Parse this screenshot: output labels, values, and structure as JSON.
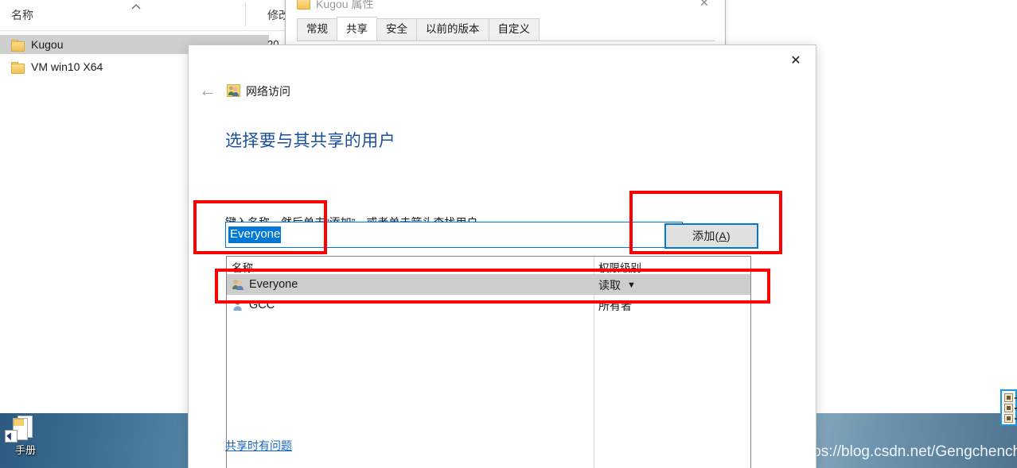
{
  "explorer": {
    "columns": [
      {
        "label": "名称",
        "name": "column-header-name"
      },
      {
        "label": "修改",
        "name": "column-header-modified"
      }
    ],
    "sort_indicator": "sort-ascending-chevron-icon",
    "rows": [
      {
        "name": "Kugou",
        "icon": "folder-icon",
        "selected": true,
        "modified": "20"
      },
      {
        "name": "VM win10 X64",
        "icon": "folder-icon",
        "selected": false,
        "modified": ""
      }
    ]
  },
  "properties_window": {
    "title": "Kugou 属性",
    "icon": "folder-icon",
    "close_label": "✕",
    "tabs": [
      {
        "label": "常规",
        "active": false
      },
      {
        "label": "共享",
        "active": true
      },
      {
        "label": "安全",
        "active": false
      },
      {
        "label": "以前的版本",
        "active": false
      },
      {
        "label": "自定义",
        "active": false
      }
    ]
  },
  "share_dialog": {
    "close_label": "✕",
    "back_label": "←",
    "header_icon": "network-access-users-icon",
    "header_title": "网络访问",
    "heading": "选择要与其共享的用户",
    "instruction": "键入名称，然后单击“添加”，或者单击箭头查找用户。",
    "combobox": {
      "value": "Everyone",
      "placeholder": "",
      "dropdown_icon": "chevron-down-icon"
    },
    "add_button": {
      "label_prefix": "添加(",
      "label_accel": "A",
      "label_suffix": ")"
    },
    "list": {
      "headers": [
        {
          "label": "名称"
        },
        {
          "label": "权限级别"
        }
      ],
      "rows": [
        {
          "name": "Everyone",
          "icon": "group-users-icon",
          "permission": "读取",
          "permission_caret": "▼",
          "selected": true
        },
        {
          "name": "GCC",
          "icon": "single-user-icon",
          "permission": "所有者",
          "permission_caret": "",
          "selected": false
        }
      ]
    },
    "trouble_link": "共享时有问题"
  },
  "desktop": {
    "shortcut_label": "手册",
    "watermark": "https://blog.csdn.net/Gengchenchen"
  },
  "colors": {
    "accent_blue": "#0078d7",
    "heading_blue": "#1a4f9c",
    "link_blue": "#1565c0",
    "annotation_red": "#ff0000",
    "selection_gray": "#cdcdcd"
  }
}
